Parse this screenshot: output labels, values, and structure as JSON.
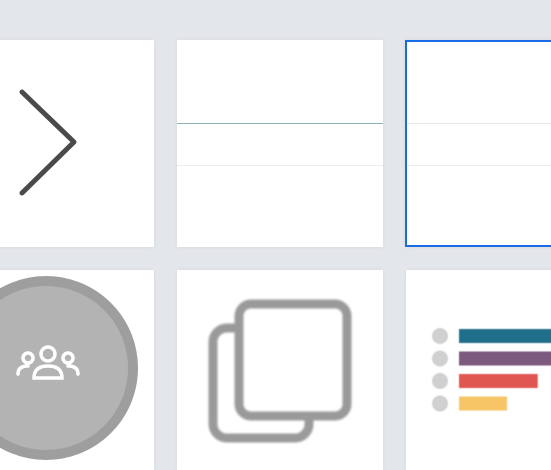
{
  "colors": {
    "background": "#e3e6ea",
    "selected_border": "#1a6be6",
    "active_rule": "#8fb0bf",
    "rule": "#ebedf0",
    "avatar_fill": "#b3b3b3",
    "avatar_ring": "#9e9e9e",
    "legend_bars": [
      "#1f6f8b",
      "#7b5a7e",
      "#e05650",
      "#f6c566"
    ],
    "legend_dot": "#d0d0d0"
  },
  "tiles": [
    {
      "icon": "chevron-right-icon"
    },
    {
      "icon": "table-layout-icon",
      "selected": false
    },
    {
      "icon": "table-layout-icon",
      "selected": true
    },
    {
      "icon": "group-users-icon"
    },
    {
      "icon": "copy-icon"
    },
    {
      "icon": "bar-legend-icon",
      "bar_levels": [
        1.0,
        1.0,
        0.82,
        0.5
      ]
    }
  ]
}
